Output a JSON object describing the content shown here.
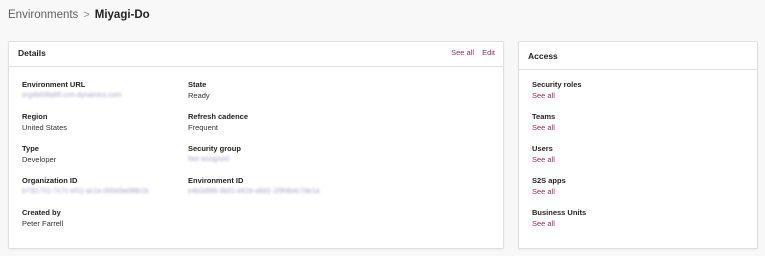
{
  "breadcrumb": {
    "parent": "Environments",
    "separator": ">",
    "current": "Miyagi-Do"
  },
  "details": {
    "title": "Details",
    "see_all": "See all",
    "edit": "Edit",
    "fields": {
      "environment_url": {
        "label": "Environment URL",
        "value": "org4b03fa85.crm.dynamics.com"
      },
      "state": {
        "label": "State",
        "value": "Ready"
      },
      "region": {
        "label": "Region",
        "value": "United States"
      },
      "refresh_cadence": {
        "label": "Refresh cadence",
        "value": "Frequent"
      },
      "type": {
        "label": "Type",
        "value": "Developer"
      },
      "security_group": {
        "label": "Security group",
        "value": "Not assigned"
      },
      "organization_id": {
        "label": "Organization ID",
        "value": "b73f1701-7c7c-ef11-ac1e-000d3a0f8b1b"
      },
      "environment_id": {
        "label": "Environment ID",
        "value": "e4b3d9f8-3b01-e61b-a6d1-1f9f4b4c7de1a"
      },
      "created_by": {
        "label": "Created by",
        "value": "Peter Farrell"
      }
    }
  },
  "access": {
    "title": "Access",
    "items": [
      {
        "label": "Security roles",
        "link": "See all"
      },
      {
        "label": "Teams",
        "link": "See all"
      },
      {
        "label": "Users",
        "link": "See all"
      },
      {
        "label": "S2S apps",
        "link": "See all"
      },
      {
        "label": "Business Units",
        "link": "See all"
      }
    ]
  }
}
